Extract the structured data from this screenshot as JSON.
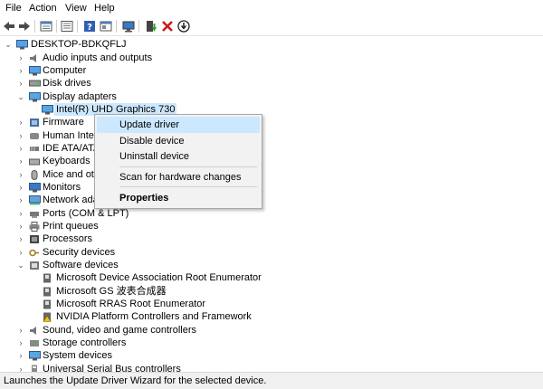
{
  "menu": {
    "file": "File",
    "action": "Action",
    "view": "View",
    "help": "Help"
  },
  "toolbar_icons": [
    "back-icon",
    "forward-icon",
    "properties-icon",
    "list-icon",
    "help-icon",
    "view-icon",
    "monitor-icon",
    "update-driver-icon",
    "uninstall-icon",
    "download-icon"
  ],
  "tree": {
    "root": "DESKTOP-BDKQFLJ",
    "items": [
      "Audio inputs and outputs",
      "Computer",
      "Disk drives",
      "Display adapters",
      "Intel(R) UHD Graphics 730",
      "Firmware",
      "Human Interf",
      "IDE ATA/ATAP",
      "Keyboards",
      "Mice and oth",
      "Monitors",
      "Network adap",
      "Ports (COM & LPT)",
      "Print queues",
      "Processors",
      "Security devices",
      "Software devices",
      "Microsoft Device Association Root Enumerator",
      "Microsoft GS 波表合成器",
      "Microsoft RRAS Root Enumerator",
      "NVIDIA Platform Controllers and Framework",
      "Sound, video and game controllers",
      "Storage controllers",
      "System devices",
      "Universal Serial Bus controllers"
    ]
  },
  "context_menu": {
    "update_driver": "Update driver",
    "disable_device": "Disable device",
    "uninstall_device": "Uninstall device",
    "scan_hardware": "Scan for hardware changes",
    "properties": "Properties"
  },
  "status": "Launches the Update Driver Wizard for the selected device.",
  "colors": {
    "highlight": "#cce8ff",
    "menu_bg": "#f2f2f2",
    "status_bg": "#f0f0f0"
  }
}
